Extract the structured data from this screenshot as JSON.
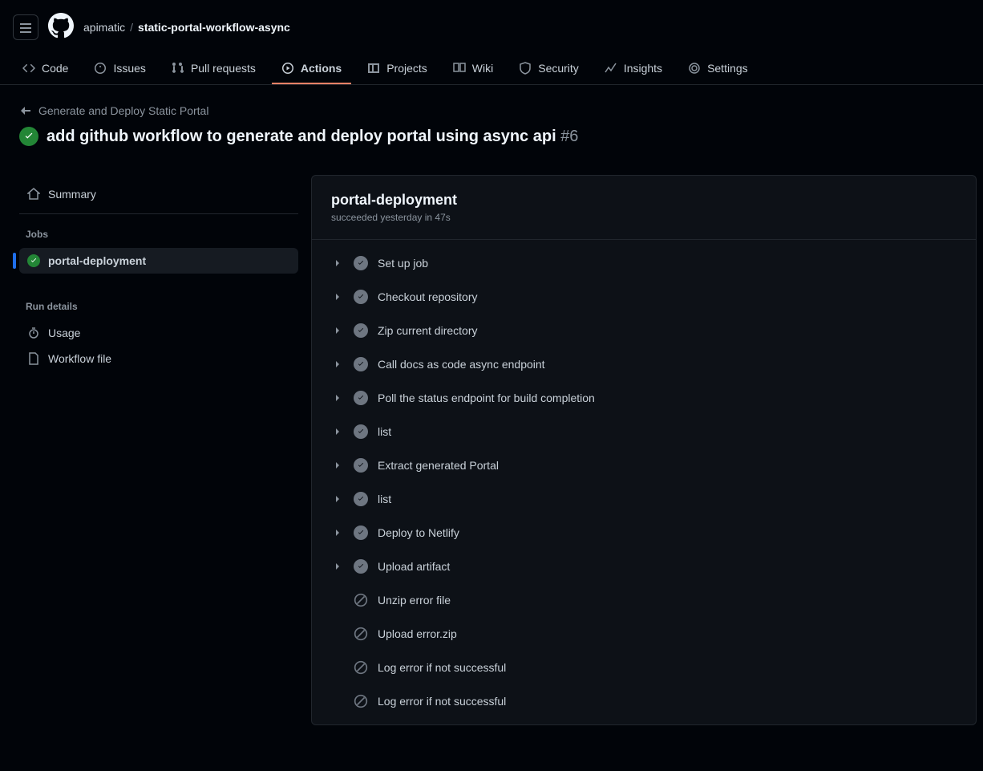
{
  "breadcrumb": {
    "owner": "apimatic",
    "repo": "static-portal-workflow-async"
  },
  "tabs": [
    {
      "label": "Code"
    },
    {
      "label": "Issues"
    },
    {
      "label": "Pull requests"
    },
    {
      "label": "Actions"
    },
    {
      "label": "Projects"
    },
    {
      "label": "Wiki"
    },
    {
      "label": "Security"
    },
    {
      "label": "Insights"
    },
    {
      "label": "Settings"
    }
  ],
  "back_link": "Generate and Deploy Static Portal",
  "run_title": "add github workflow to generate and deploy portal using async api",
  "run_number": "#6",
  "sidebar": {
    "summary": "Summary",
    "jobs_heading": "Jobs",
    "jobs": [
      {
        "label": "portal-deployment"
      }
    ],
    "run_details_heading": "Run details",
    "usage": "Usage",
    "workflow_file": "Workflow file"
  },
  "job": {
    "title": "portal-deployment",
    "subtitle": "succeeded yesterday in 47s",
    "steps": [
      {
        "label": "Set up job",
        "status": "success",
        "expandable": true
      },
      {
        "label": "Checkout repository",
        "status": "success",
        "expandable": true
      },
      {
        "label": "Zip current directory",
        "status": "success",
        "expandable": true
      },
      {
        "label": "Call docs as code async endpoint",
        "status": "success",
        "expandable": true
      },
      {
        "label": "Poll the status endpoint for build completion",
        "status": "success",
        "expandable": true
      },
      {
        "label": "list",
        "status": "success",
        "expandable": true
      },
      {
        "label": "Extract generated Portal",
        "status": "success",
        "expandable": true
      },
      {
        "label": "list",
        "status": "success",
        "expandable": true
      },
      {
        "label": "Deploy to Netlify",
        "status": "success",
        "expandable": true
      },
      {
        "label": "Upload artifact",
        "status": "success",
        "expandable": true
      },
      {
        "label": "Unzip error file",
        "status": "skipped",
        "expandable": false
      },
      {
        "label": "Upload error.zip",
        "status": "skipped",
        "expandable": false
      },
      {
        "label": "Log error if not successful",
        "status": "skipped",
        "expandable": false
      },
      {
        "label": "Log error if not successful",
        "status": "skipped",
        "expandable": false
      }
    ]
  }
}
